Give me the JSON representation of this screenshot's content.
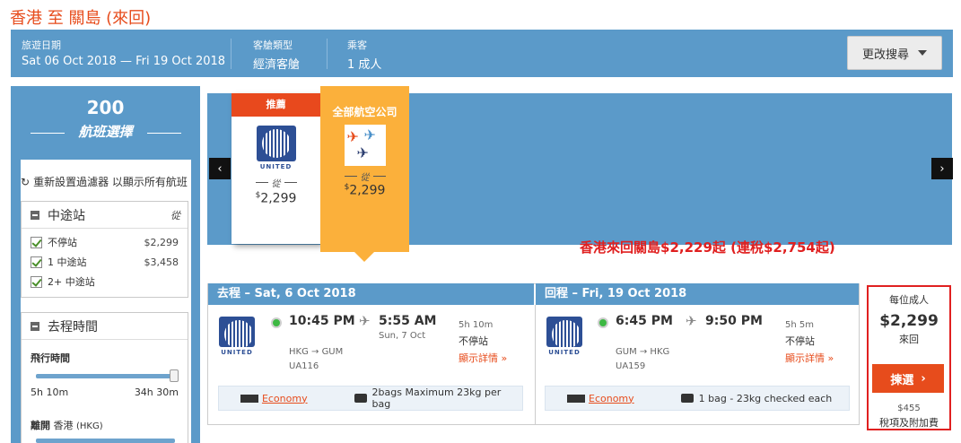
{
  "title": "香港 至 關島 (來回)",
  "search_bar": {
    "dates_label": "旅遊日期",
    "dates_value": "Sat 06 Oct 2018 — Fri 19 Oct 2018",
    "cabin_label": "客艙類型",
    "cabin_value": "經濟客艙",
    "pax_label": "乘客",
    "pax_value": "1 成人",
    "change_label": "更改搜尋"
  },
  "sidebar": {
    "count": "200",
    "caption": "航班選擇",
    "reset_text": "重新設置過濾器 以顯示所有航班",
    "stops": {
      "title": "中途站",
      "items": [
        {
          "label": "不停站",
          "price": "$2,299"
        },
        {
          "label": "1 中途站",
          "price": "$3,458"
        },
        {
          "label": "2+ 中途站",
          "price": ""
        }
      ]
    },
    "times": {
      "title": "去程時間",
      "flight_time_label": "飛行時間",
      "min": "5h 10m",
      "max": "34h 30m",
      "depart_label": "離開",
      "depart_city": "香港",
      "depart_code": "(HKG)"
    }
  },
  "carousel": {
    "card1_header": "推薦",
    "card1_airline": "UNITED",
    "card1_from": "從",
    "card1_currency": "$",
    "card1_price": "2,299",
    "card2_header": "全部航空公司",
    "card2_from": "從",
    "card2_currency": "$",
    "card2_price": "2,299",
    "prev": "‹",
    "next": "›"
  },
  "promo": "香港來回關島$2,229起 (連稅$2,754起)",
  "result": {
    "outbound": {
      "header": "去程 – Sat, 6 Oct 2018",
      "airline": "UNITED",
      "dep_time": "10:45 PM",
      "arr_time": "5:55 AM",
      "arr_date": "Sun, 7 Oct",
      "route": "HKG → GUM",
      "flight_no": "UA116",
      "duration": "5h 10m",
      "stops": "不停站",
      "details": "顯示詳情",
      "fare_class": "Economy",
      "baggage": "2bags Maximum 23kg per bag"
    },
    "inbound": {
      "header": "回程 – Fri, 19 Oct 2018",
      "airline": "UNITED",
      "dep_time": "6:45 PM",
      "arr_time": "9:50 PM",
      "route": "GUM → HKG",
      "flight_no": "UA159",
      "duration": "5h 5m",
      "stops": "不停站",
      "details": "顯示詳情",
      "fare_class": "Economy",
      "baggage": "1 bag - 23kg checked each"
    },
    "price_box": {
      "per": "每位成人",
      "price": "$2,299",
      "trip": "來回",
      "select": "揀選",
      "tax": "$455",
      "tax_label": "稅項及附加費"
    }
  }
}
